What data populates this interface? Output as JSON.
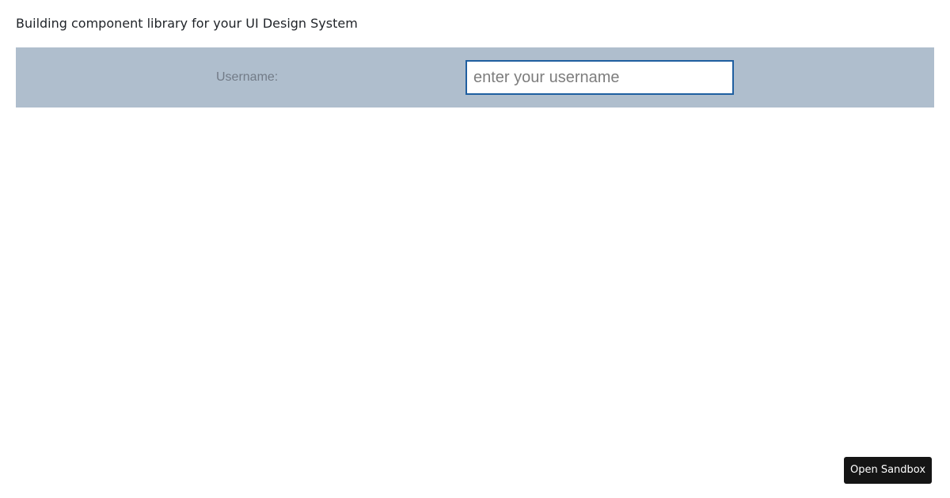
{
  "page": {
    "title": "Building component library for your UI Design System"
  },
  "form": {
    "username_label": "Username:",
    "username_placeholder": "enter your username",
    "username_value": ""
  },
  "footer": {
    "open_sandbox_label": "Open Sandbox"
  },
  "colors": {
    "form_bar_background": "#afbecd",
    "input_border": "#1f5fa0",
    "label_text": "#727b87",
    "button_background": "#151515"
  }
}
